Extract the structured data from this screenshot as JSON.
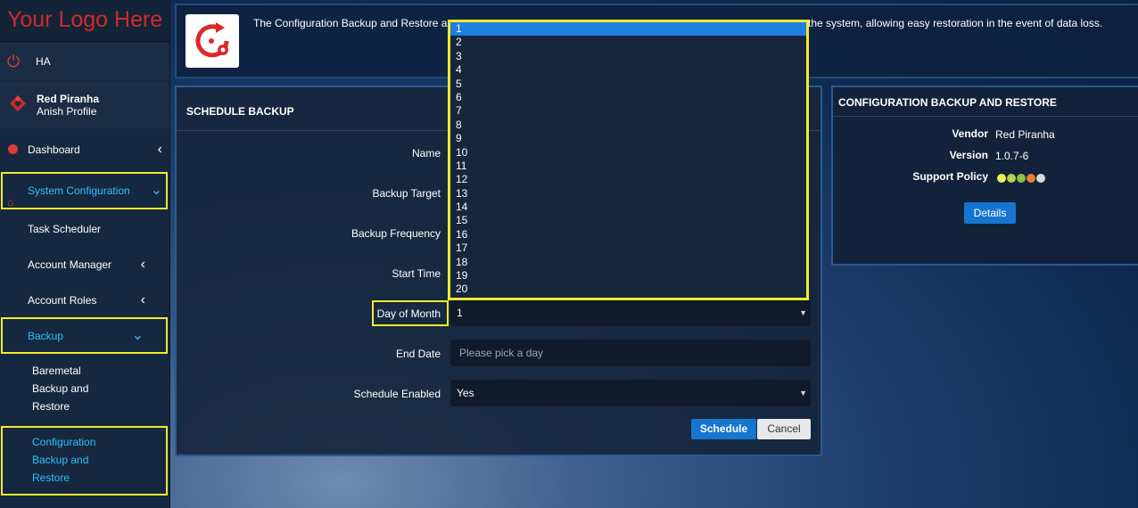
{
  "app": {
    "logo_text": "Your Logo Here"
  },
  "sidebar": {
    "ha_label": "HA",
    "profile": {
      "name": "Red Piranha",
      "sub": "Anish Profile"
    },
    "dashboard": "Dashboard",
    "system_configuration": "System Configuration",
    "task_scheduler": "Task Scheduler",
    "account_manager": "Account Manager",
    "account_roles": "Account Roles",
    "backup": "Backup",
    "baremetal": [
      "Baremetal",
      "Backup and",
      "Restore"
    ],
    "config_backup": [
      "Configuration",
      "Backup and",
      "Restore"
    ],
    "chevron_left": "‹",
    "chevron_down": "⌄"
  },
  "banner": {
    "text_left": "The Configuration Backup and Restore a",
    "text_right": "the system, allowing easy restoration in the event of data loss."
  },
  "schedule": {
    "title": "SCHEDULE BACKUP",
    "labels": {
      "name": "Name",
      "target": "Backup Target",
      "frequency": "Backup Frequency",
      "start_time": "Start Time",
      "day_of_month": "Day of Month",
      "end_date": "End Date",
      "schedule_enabled": "Schedule Enabled"
    },
    "day_of_month_value": "1",
    "end_date_placeholder": "Please pick a day",
    "schedule_enabled_value": "Yes",
    "schedule_button": "Schedule",
    "cancel_button": "Cancel"
  },
  "dropdown": {
    "options": [
      "1",
      "2",
      "3",
      "4",
      "5",
      "6",
      "7",
      "8",
      "9",
      "10",
      "11",
      "12",
      "13",
      "14",
      "15",
      "16",
      "17",
      "18",
      "19",
      "20"
    ],
    "selected": "1"
  },
  "info": {
    "title": "CONFIGURATION BACKUP AND RESTORE",
    "vendor_label": "Vendor",
    "vendor_value": "Red Piranha",
    "version_label": "Version",
    "version_value": "1.0.7-6",
    "support_label": "Support Policy",
    "support_colors": [
      "#f0f05a",
      "#b8d24a",
      "#8cc04a",
      "#e8832a",
      "#d9d9d9"
    ],
    "details_button": "Details"
  },
  "colors": {
    "accent": "#2ec0ff",
    "highlight": "#f3ea2c",
    "brand_red": "#d32a2a",
    "button_blue": "#1676cf"
  }
}
